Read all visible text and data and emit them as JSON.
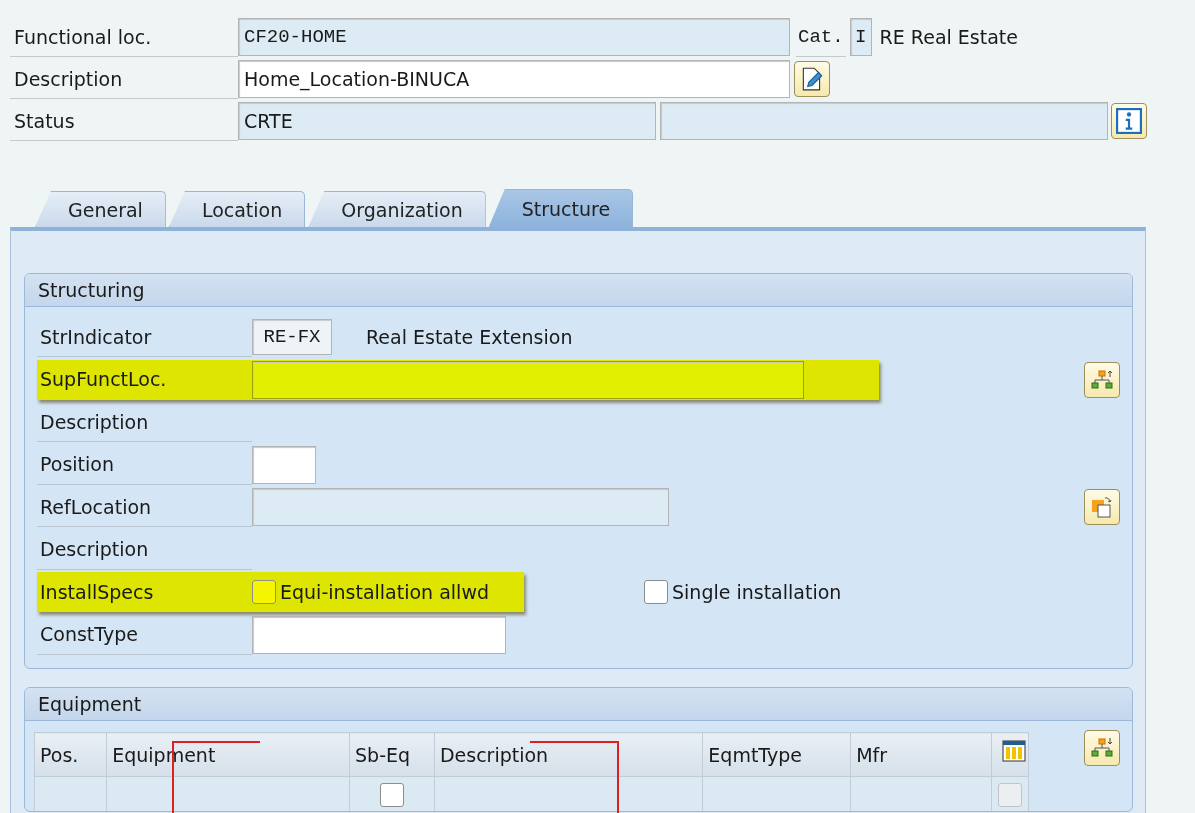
{
  "header": {
    "fields": [
      {
        "kind": "code",
        "label": "Functional loc.",
        "value": "CF20-HOME",
        "editable": false,
        "category": {
          "label": "Cat.",
          "value": "I",
          "text": "RE Real Estate"
        }
      },
      {
        "kind": "edit",
        "label": "Description",
        "value": "Home_Location-BINUCA",
        "editable": true
      },
      {
        "kind": "status",
        "label": "Status",
        "value": "CRTE",
        "editable": false
      }
    ]
  },
  "tabs": [
    {
      "label": "General",
      "selected": false
    },
    {
      "label": "Location",
      "selected": false
    },
    {
      "label": "Organization",
      "selected": false
    },
    {
      "label": "Structure",
      "selected": true
    }
  ],
  "structuring": {
    "title": "Structuring",
    "rows": [
      {
        "kind": "code",
        "label": "StrIndicator",
        "value": "RE-FX",
        "text": "Real Estate Extension",
        "highlighted": false
      },
      {
        "kind": "long-field",
        "label": "SupFunctLoc.",
        "editable": true,
        "highlighted": true,
        "action": {
          "kind": "hierarchy"
        }
      },
      {
        "kind": "label-only",
        "label": "Description",
        "highlighted": false
      },
      {
        "kind": "short-field",
        "label": "Position",
        "editable": true,
        "highlighted": false
      },
      {
        "kind": "medium-field",
        "label": "RefLocation",
        "editable": false,
        "highlighted": false,
        "action": {
          "kind": "copy"
        }
      },
      {
        "kind": "label-only",
        "label": "Description",
        "highlighted": false
      },
      {
        "kind": "checkboxes",
        "label": "InstallSpecs",
        "highlighted": true,
        "options": [
          {
            "label": "Equi-installation allwd",
            "checked": false
          },
          {
            "label": "Single installation",
            "checked": false
          }
        ]
      },
      {
        "kind": "wide-field",
        "label": "ConstType",
        "editable": true,
        "highlighted": false
      }
    ]
  },
  "equipment": {
    "title": "Equipment",
    "table": {
      "columns": [
        "Pos.",
        "Equipment",
        "Sb-Eq",
        "Description",
        "EqmtType",
        "Mfr",
        ""
      ],
      "rows": [
        {
          "sub_equipment": false,
          "column_7_checked": false,
          "column_7_disabled": true
        }
      ]
    }
  }
}
